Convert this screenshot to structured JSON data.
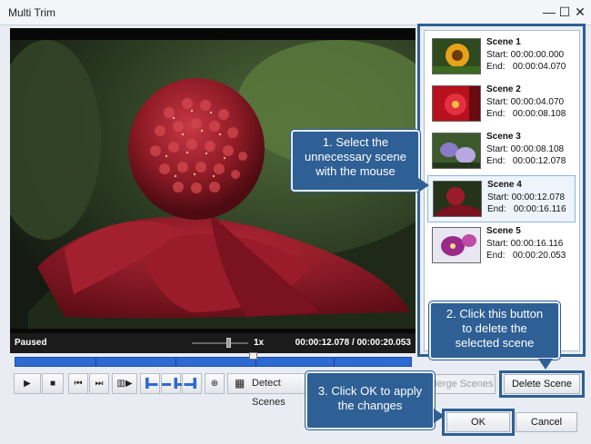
{
  "window": {
    "title": "Multi Trim",
    "minimize_glyph": "—",
    "maximize_glyph": "☐",
    "close_glyph": "✕"
  },
  "player": {
    "status": "Paused",
    "speed": "1x",
    "timecode": "00:00:12.078 / 00:00:20.053",
    "playhead_fraction": 0.6
  },
  "controls": {
    "detect_scenes_label": "Detect Scenes",
    "merge_scenes_label": "Merge Scenes",
    "delete_scene_label": "Delete Scene",
    "ok_label": "OK",
    "cancel_label": "Cancel",
    "icons": [
      "play-icon",
      "stop-icon",
      "prev-frame-icon",
      "next-frame-icon",
      "split-scene-icon",
      "marker-left-icon",
      "marker-center-icon",
      "marker-right-icon",
      "zoom-icon",
      "detect-scenes-icon"
    ]
  },
  "scenes": [
    {
      "name": "Scene 1",
      "start": "Start: 00:00:00.000",
      "end": "End:   00:00:04.070"
    },
    {
      "name": "Scene 2",
      "start": "Start: 00:00:04.070",
      "end": "End:   00:00:08.108"
    },
    {
      "name": "Scene 3",
      "start": "Start: 00:00:08.108",
      "end": "End:   00:00:12.078"
    },
    {
      "name": "Scene 4",
      "start": "Start: 00:00:12.078",
      "end": "End:   00:00:16.116"
    },
    {
      "name": "Scene 5",
      "start": "Start: 00:00:16.116",
      "end": "End:   00:00:20.053"
    }
  ],
  "selected_scene": 3,
  "callouts": {
    "select": [
      "1. Select the",
      "unnecessary scene",
      "with the mouse"
    ],
    "delete": [
      "2. Click this button",
      "to delete the",
      "selected scene"
    ],
    "ok": [
      "3. Click OK to apply",
      "the changes"
    ]
  },
  "colors": {
    "accent": "#2e5f95",
    "timeline": "#2d6ad2"
  }
}
